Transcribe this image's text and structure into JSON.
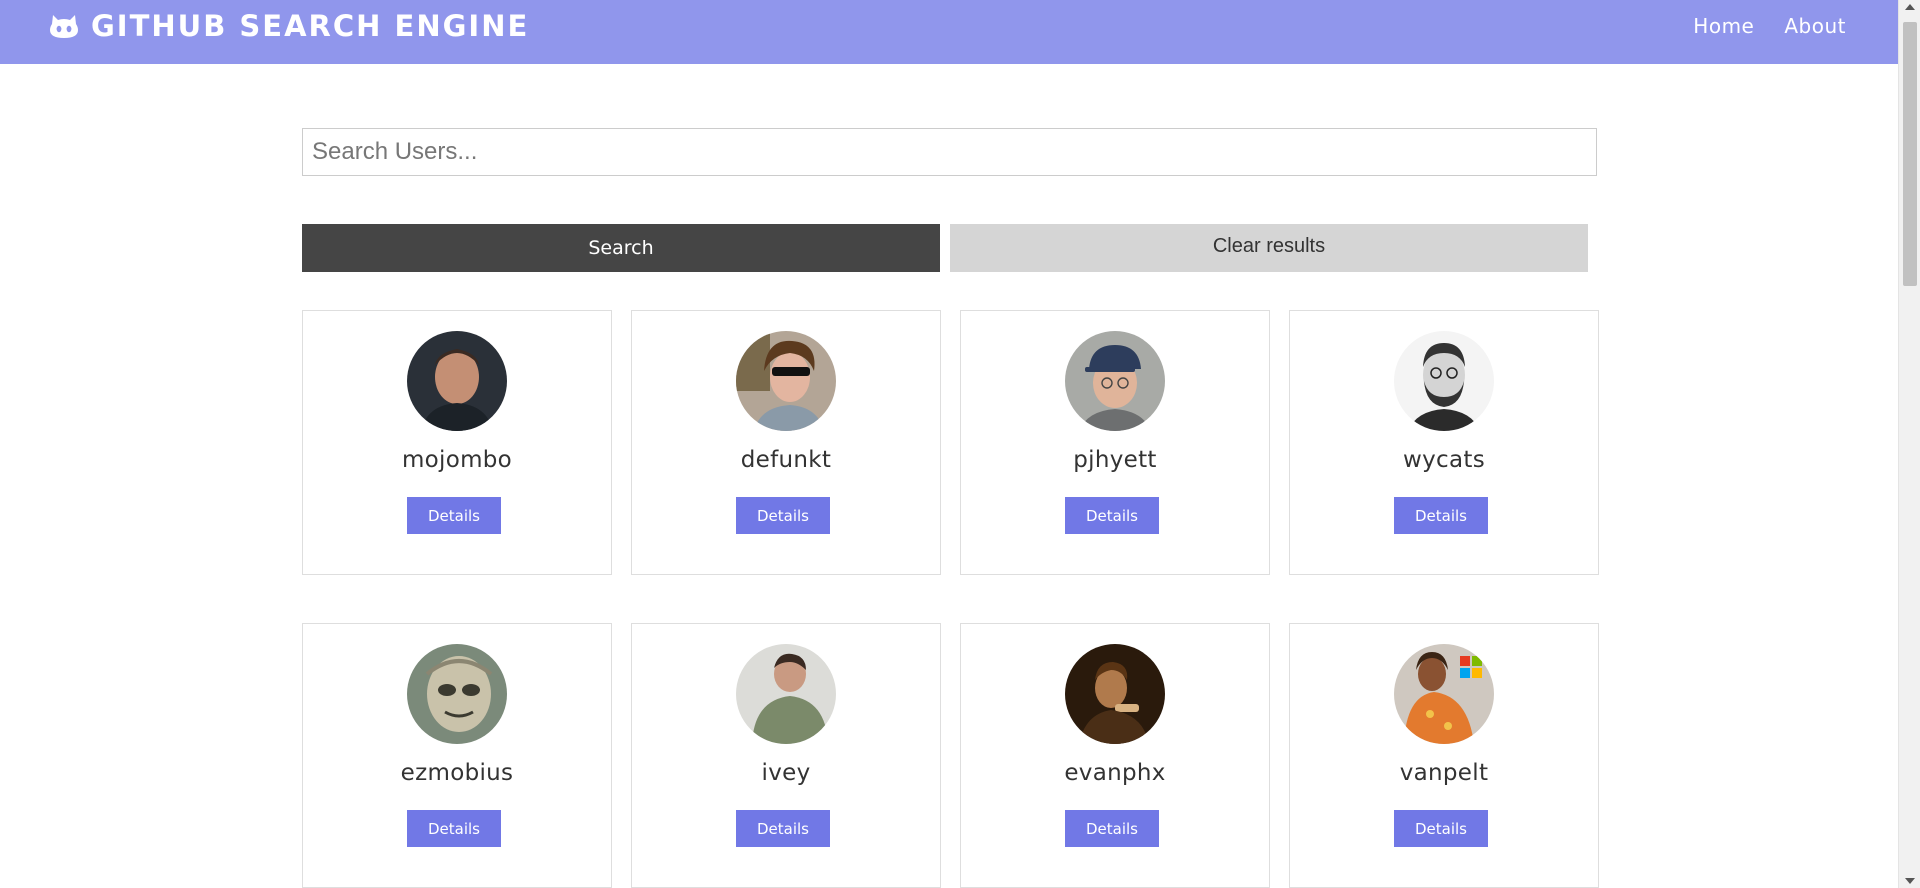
{
  "navbar": {
    "title": "GITHUB SEARCH ENGINE",
    "brand_icon": "github-cat-icon",
    "links": [
      "Home",
      "About"
    ]
  },
  "search": {
    "placeholder": "Search Users...",
    "value": "",
    "search_label": "Search",
    "clear_label": "Clear results"
  },
  "colors": {
    "navbar": "#9096ec",
    "primary_button": "#7178e6",
    "search_button": "#454545",
    "clear_button": "#d5d5d5"
  },
  "users": [
    {
      "login": "mojombo",
      "details_label": "Details",
      "avatar_icon": "avatar-photo"
    },
    {
      "login": "defunkt",
      "details_label": "Details",
      "avatar_icon": "avatar-photo"
    },
    {
      "login": "pjhyett",
      "details_label": "Details",
      "avatar_icon": "avatar-photo"
    },
    {
      "login": "wycats",
      "details_label": "Details",
      "avatar_icon": "avatar-photo"
    },
    {
      "login": "ezmobius",
      "details_label": "Details",
      "avatar_icon": "avatar-photo"
    },
    {
      "login": "ivey",
      "details_label": "Details",
      "avatar_icon": "avatar-photo"
    },
    {
      "login": "evanphx",
      "details_label": "Details",
      "avatar_icon": "avatar-photo"
    },
    {
      "login": "vanpelt",
      "details_label": "Details",
      "avatar_icon": "avatar-photo"
    }
  ]
}
